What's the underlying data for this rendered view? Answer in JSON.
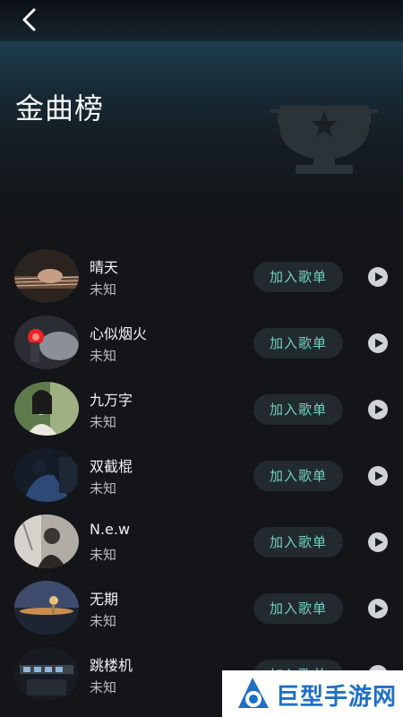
{
  "nav": {
    "back_icon": "chevron-left-icon"
  },
  "header": {
    "title": "金曲榜",
    "trophy_icon": "trophy-icon"
  },
  "songs": [
    {
      "title": "晴天",
      "artist": "未知",
      "add_label": "加入歌单"
    },
    {
      "title": "心似烟火",
      "artist": "未知",
      "add_label": "加入歌单"
    },
    {
      "title": "九万字",
      "artist": "未知",
      "add_label": "加入歌单"
    },
    {
      "title": "双截棍",
      "artist": "未知",
      "add_label": "加入歌单"
    },
    {
      "title": "N.e.w",
      "artist": "未知",
      "add_label": "加入歌单"
    },
    {
      "title": "无期",
      "artist": "未知",
      "add_label": "加入歌单"
    },
    {
      "title": "跳楼机",
      "artist": "未知",
      "add_label": "加入歌单"
    }
  ],
  "watermark": {
    "text": "巨型手游网"
  },
  "colors": {
    "accent": "#6fcfc0",
    "background": "#131519",
    "button_bg": "#232a2f",
    "watermark_blue": "#1f6fc4"
  }
}
